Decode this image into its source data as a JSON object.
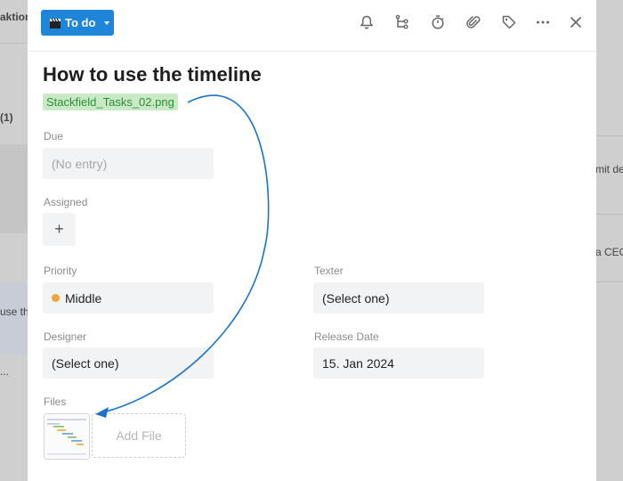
{
  "background": {
    "left_texts": [
      "aktion",
      "(1)",
      "use th",
      "..."
    ],
    "right_texts": [
      "mit de",
      "a CEO"
    ]
  },
  "toolbar": {
    "status_label": "To do",
    "status_icon": "clapperboard-icon",
    "icons": [
      "bell-icon",
      "subtasks-icon",
      "stopwatch-icon",
      "paperclip-icon",
      "tag-icon",
      "more-icon",
      "close-icon"
    ]
  },
  "task": {
    "title": "How to use the timeline",
    "attachment_tag": "Stackfield_Tasks_02.png"
  },
  "fields": {
    "due": {
      "label": "Due",
      "value": "(No entry)"
    },
    "assigned": {
      "label": "Assigned",
      "add": "+"
    },
    "priority": {
      "label": "Priority",
      "value": "Middle",
      "color": "#f0a53a"
    },
    "texter": {
      "label": "Texter",
      "value": "(Select one)"
    },
    "designer": {
      "label": "Designer",
      "value": "(Select one)"
    },
    "release_date": {
      "label": "Release Date",
      "value": "15. Jan 2024"
    },
    "files": {
      "label": "Files",
      "add_file": "Add File"
    }
  },
  "colors": {
    "accent": "#1f85d8",
    "tag_bg": "#c8ebc6",
    "tag_text": "#2c8c37",
    "arrow": "#1a73c8"
  }
}
